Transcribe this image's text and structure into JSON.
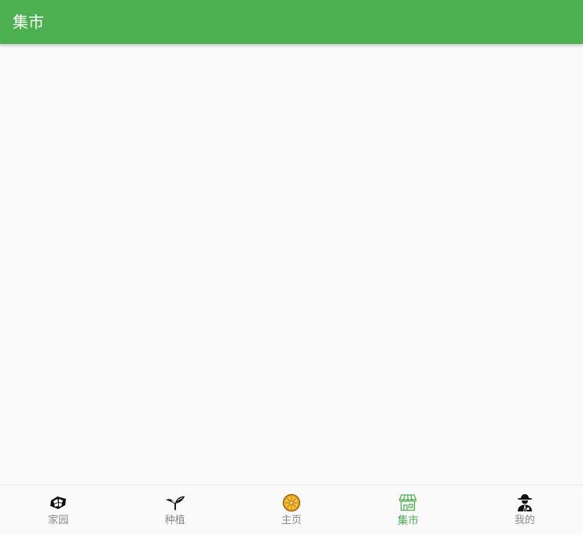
{
  "appbar": {
    "title": "集市"
  },
  "colors": {
    "primary": "#4caf50",
    "inactive_label": "#8a8a8a",
    "background": "#fafafa"
  },
  "bottom_nav": {
    "active_index": 3,
    "items": [
      {
        "label": "家园",
        "icon": "home-garden-icon"
      },
      {
        "label": "种植",
        "icon": "sprout-icon"
      },
      {
        "label": "主页",
        "icon": "orange-slice-icon"
      },
      {
        "label": "集市",
        "icon": "market-stall-icon"
      },
      {
        "label": "我的",
        "icon": "farmer-avatar-icon"
      }
    ]
  }
}
